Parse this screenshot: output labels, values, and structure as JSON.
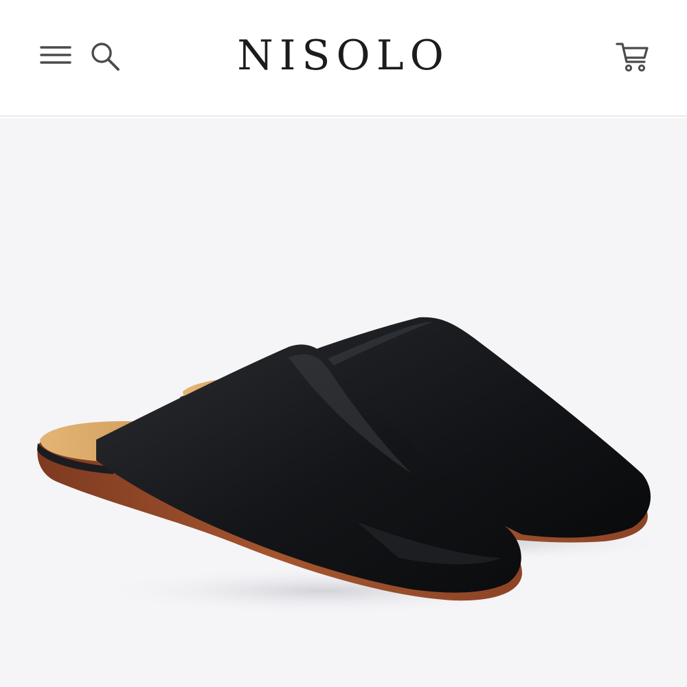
{
  "header": {
    "brand": "NISOLO",
    "menu_icon": "hamburger-menu-icon",
    "search_icon": "search-icon",
    "cart_icon": "cart-icon"
  },
  "hero": {
    "image_subject": "product-image",
    "colors": {
      "background": "#f5f5f8",
      "leather": "#151618",
      "footbed": "#d9a866",
      "sole": "#9a4b2b"
    }
  }
}
